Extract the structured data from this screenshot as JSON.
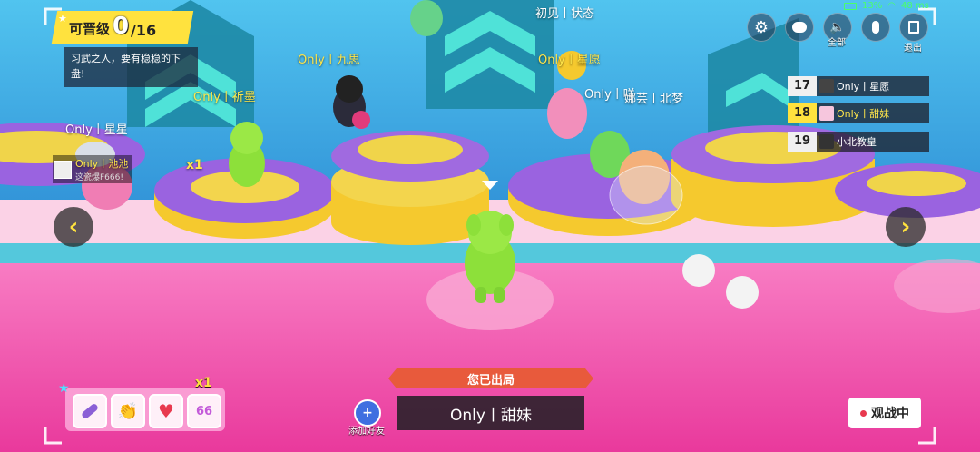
{
  "status": {
    "battery": "13%",
    "ping": "48 ms"
  },
  "promotion": {
    "title": "可晋级",
    "current": "0",
    "total": "/16",
    "message": "习武之人，要有稳稳的下盘!"
  },
  "top_buttons": {
    "all_label": "全部",
    "exit_label": "退出"
  },
  "nameplates": {
    "top_center": "初见丨状态",
    "p1": "Only丨九思",
    "p2": "Only丨星愿",
    "p3": "Only丨祈墨",
    "p4": "Only丨星星",
    "p5": "Only丨咩",
    "p6": "娜芸丨北梦",
    "p7_name": "Only丨池池",
    "p7_sub": "这瓷爆F666!",
    "combo": "x1"
  },
  "leaderboard": [
    {
      "rank": "17",
      "name": "Only丨星愿",
      "highlight": false
    },
    {
      "rank": "18",
      "name": "Only丨甜妹",
      "highlight": true
    },
    {
      "rank": "19",
      "name": "小北教皇",
      "highlight": false
    }
  ],
  "bottom": {
    "eliminated": "您已出局",
    "player_name": "Only丨甜妹",
    "add_friend": "添加好友",
    "spectating": "观战中",
    "item_count": "x1"
  },
  "colors": {
    "sky": "#3fb6e6",
    "floor": "#f04ea8",
    "accent_yellow": "#ffe64a",
    "eliminated_bar": "#e85a3c"
  }
}
